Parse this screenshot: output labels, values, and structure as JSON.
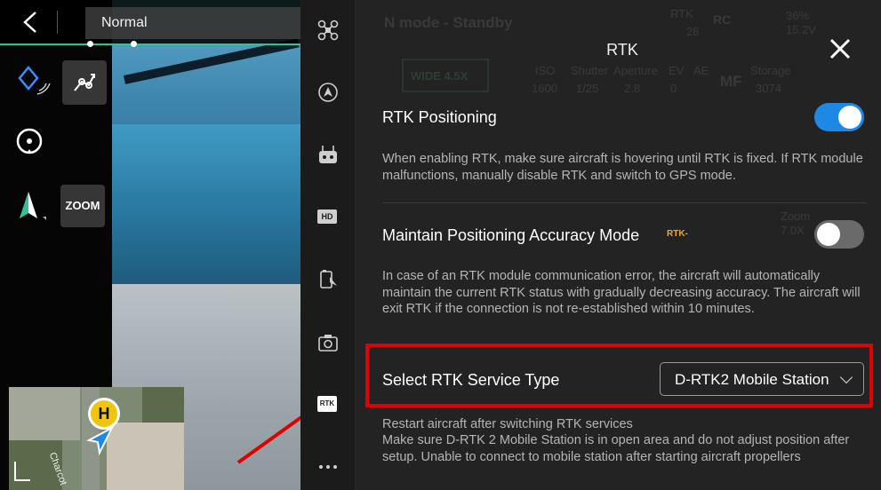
{
  "camera": {
    "flight_mode": "Normal",
    "zoom_label": "ZOOM",
    "map": {
      "home_marker": "H",
      "street_label": "Charcot"
    }
  },
  "rail": {
    "icons": [
      "drone-icon",
      "obstacle-avoidance-icon",
      "remote-controller-icon",
      "hd-transmission-icon",
      "battery-icon",
      "camera-icon",
      "rtk-icon",
      "more-icon"
    ],
    "hd_label": "HD",
    "rtk_label": "RTK"
  },
  "background_status": {
    "mode_text": "N mode - Standby",
    "rtk": "RTK",
    "rtk_sats": "28",
    "rc": "RC",
    "battery_pct": "36%",
    "battery_v": "15.2V",
    "wide_label": "WIDE 4.5X",
    "iso_label": "ISO",
    "iso": "1600",
    "shutter_label": "Shutter",
    "shutter": "1/25",
    "aperture_label": "Aperture",
    "aperture": "2.8",
    "ev_label": "EV",
    "ev": "0",
    "ae_label": "AE",
    "mf": "MF",
    "storage_label": "Storage",
    "storage": "3074",
    "zoom_overlay": "Zoom",
    "zoom_overlay_val": "7.0X"
  },
  "panel": {
    "title": "RTK",
    "rtk_positioning": {
      "label": "RTK Positioning",
      "enabled": true,
      "description": "When enabling RTK, make sure aircraft is hovering until RTK is fixed. If RTK module malfunctions, manually disable RTK and switch to GPS mode."
    },
    "accuracy_mode": {
      "label": "Maintain Positioning Accuracy Mode",
      "tag": "RTK-",
      "enabled": false,
      "description": "In case of an RTK module communication error, the aircraft will automatically maintain the current RTK status with gradually decreasing accuracy. The aircraft will exit RTK if the connection is not re-established within 10 minutes."
    },
    "service_type": {
      "label": "Select RTK Service Type",
      "value": "D-RTK2 Mobile Station",
      "note_1": "Restart aircraft after switching RTK services",
      "note_2": "Make sure D-RTK 2 Mobile Station is in open area and do not adjust position after setup. Unable to connect to mobile station after starting aircraft propellers"
    }
  },
  "colors": {
    "accent_blue": "#1e88e5",
    "highlight_red": "#e00000",
    "gps_green": "#2ec29a",
    "rtk_tag_orange": "#f5a623"
  }
}
